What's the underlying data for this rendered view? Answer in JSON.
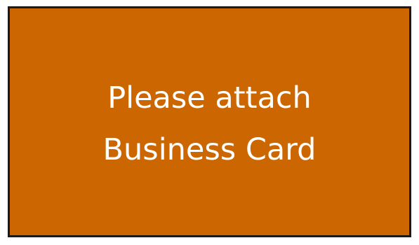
{
  "card": {
    "background_color": "#cc6600",
    "border_color": "#1a1a1a",
    "text_color": "#ffffff",
    "line1": "Please attach",
    "line2": "Business Card"
  }
}
